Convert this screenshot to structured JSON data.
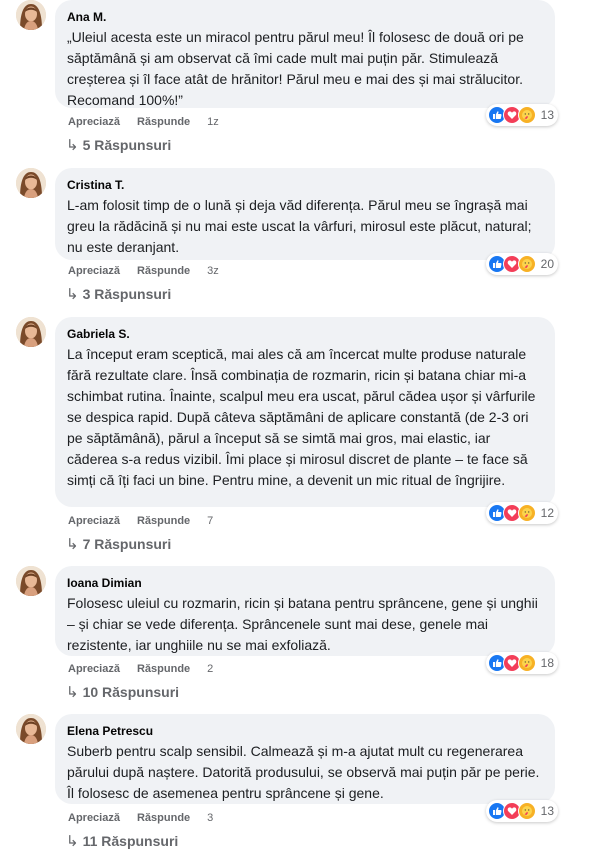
{
  "labels": {
    "like": "Apreciază",
    "reply": "Răspunde"
  },
  "comments": [
    {
      "author": "Ana M.",
      "text": "„Uleiul acesta este un miracol pentru părul meu! Îl folosesc de două ori pe săptămână și am observat că îmi cade mult mai puțin păr. Stimulează creșterea și îl face atât de hrănitor! Părul meu e mai des și mai strălucitor. Recomand 100%!”",
      "time": "1z",
      "reactions": "13",
      "replies": "5 Răspunsuri"
    },
    {
      "author": "Cristina T.",
      "text": "L-am folosit timp de o lună și deja văd diferența. Părul meu se îngrașă mai greu la rădăcină și nu mai este uscat la vârfuri, mirosul este plăcut, natural; nu este deranjant.",
      "time": "3z",
      "reactions": "20",
      "replies": "3 Răspunsuri"
    },
    {
      "author": "Gabriela S.",
      "text": "La început eram sceptică, mai ales că am încercat multe produse naturale fără rezultate clare. Însă combinația de rozmarin, ricin și batana chiar mi-a schimbat rutina. Înainte, scalpul meu era uscat, părul cădea ușor și vârfurile se despica rapid. După câteva săptămâni de aplicare constantă (de 2-3 ori pe săptămână), părul a început să se simtă mai gros, mai elastic, iar căderea s-a redus vizibil. Îmi place și mirosul discret de plante – te face să simți că îți faci un bine. Pentru mine, a devenit un mic ritual de îngrijire.",
      "time": "7",
      "reactions": "12",
      "replies": "7 Răspunsuri"
    },
    {
      "author": "Ioana Dimian",
      "text": "Folosesc uleiul cu rozmarin, ricin și batana pentru sprâncene, gene și unghii – și chiar se vede diferența. Sprâncenele sunt mai dese, genele mai rezistente, iar unghiile nu se mai exfoliază.",
      "time": "2",
      "reactions": "18",
      "replies": "10 Răspunsuri"
    },
    {
      "author": "Elena Petrescu",
      "text": "Suberb pentru scalp sensibil. Calmează și m-a ajutat mult cu regenerarea părului după naștere. Datorită produsului, se observă mai puțin păr pe perie. Îl folosesc de asemenea pentru sprâncene și gene.",
      "time": "3",
      "reactions": "13",
      "replies": "11 Răspunsuri"
    }
  ]
}
